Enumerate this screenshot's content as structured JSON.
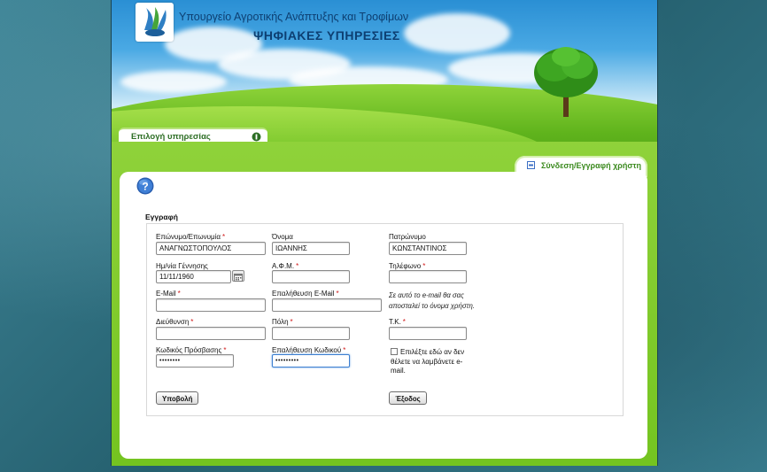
{
  "header": {
    "ministry_name": "Υπουργείο Αγροτικής Ανάπτυξης και Τροφίμων",
    "services_title": "ΨΗΦΙΑΚΕΣ ΥΠΗΡΕΣΙΕΣ",
    "service_tab_label": "Επιλογή υπηρεσίας",
    "login_tab_label": "Σύνδεση/Εγγραφή χρήστη"
  },
  "form": {
    "section_title": "Εγγραφή",
    "surname": {
      "label": "Επώνυμο/Επωνυμία",
      "required_mark": "*",
      "value": "ΑΝΑΓΝΩΣΤΟΠΟΥΛΟΣ"
    },
    "first_name": {
      "label": "Όνομα",
      "value": "ΙΩΑΝΝΗΣ"
    },
    "father_name": {
      "label": "Πατρώνυμο",
      "value": "ΚΩΝΣΤΑΝΤΙΝΟΣ"
    },
    "birth_date": {
      "label": "Ημ/νία Γέννησης",
      "value": "11/11/1960"
    },
    "afm": {
      "label": "Α.Φ.Μ.",
      "required_mark": "*",
      "value": ""
    },
    "phone": {
      "label": "Τηλέφωνο",
      "required_mark": "*",
      "value": ""
    },
    "email": {
      "label": "E-Mail",
      "required_mark": "*",
      "value": ""
    },
    "email_confirm": {
      "label": "Επαλήθευση E-Mail",
      "required_mark": "*",
      "value": ""
    },
    "email_note_line1": "Σε αυτό το e-mail θα σας",
    "email_note_line2": "αποσταλεί το όνομα χρήστη.",
    "address": {
      "label": "Διεύθυνση",
      "required_mark": "*",
      "value": ""
    },
    "city": {
      "label": "Πόλη",
      "required_mark": "*",
      "value": ""
    },
    "postal_code": {
      "label": "Τ.Κ.",
      "required_mark": "*",
      "value": ""
    },
    "password": {
      "label": "Κωδικός Πρόσβασης",
      "required_mark": "*",
      "value": "••••••••"
    },
    "password_confirm": {
      "label": "Επαλήθευση Κωδικού",
      "required_mark": "*",
      "value": "•••••••••"
    },
    "optout_line1": "Επιλέξτε εδώ αν δεν",
    "optout_line2": "θέλετε να λαμβάνετε e-",
    "optout_line3": "mail.",
    "submit_label": "Υποβολή",
    "exit_label": "Έξοδος"
  },
  "colors": {
    "brand_dark_blue": "#0d3f72",
    "frame_green": "#7cc62a",
    "required_red": "#d01818"
  }
}
